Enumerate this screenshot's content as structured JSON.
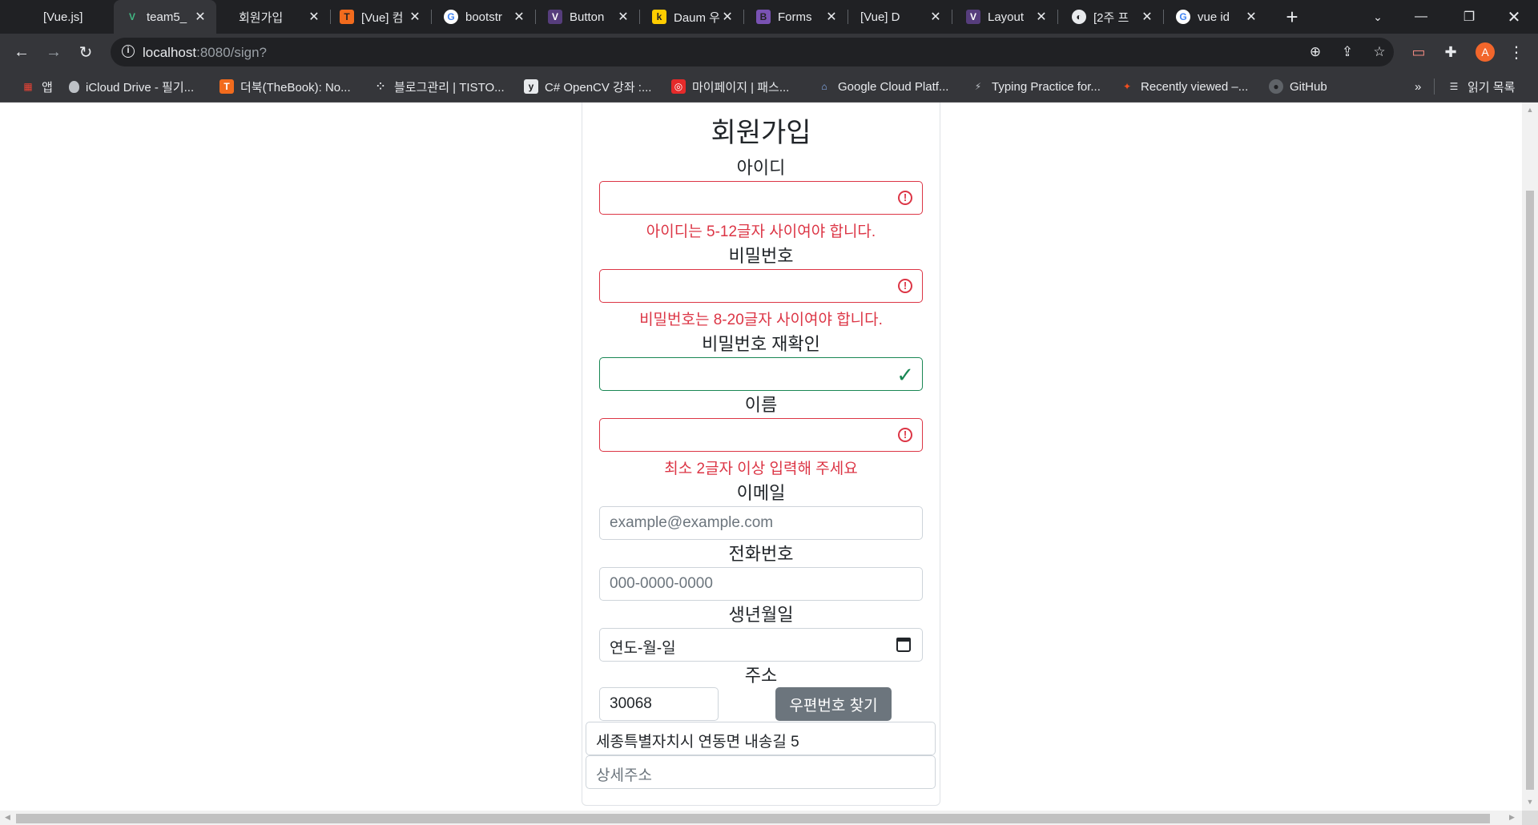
{
  "browser": {
    "tabs": [
      {
        "title": "[Vue.js]",
        "icon": "",
        "icon_bg": "",
        "active": false
      },
      {
        "title": "team5_",
        "icon": "V",
        "icon_bg": "vue",
        "active": true
      },
      {
        "title": "회원가입",
        "icon": "",
        "icon_bg": "",
        "active": false
      },
      {
        "title": "[Vue] 컴",
        "icon": "T",
        "icon_bg": "#f26b1d",
        "active": false
      },
      {
        "title": "bootstr",
        "icon": "G",
        "icon_bg": "google",
        "active": false
      },
      {
        "title": "Button",
        "icon": "V",
        "icon_bg": "bvue",
        "active": false
      },
      {
        "title": "Daum 우",
        "icon": "k",
        "icon_bg": "#ffcd00",
        "active": false
      },
      {
        "title": "Forms",
        "icon": "B",
        "icon_bg": "#7952b3",
        "active": false
      },
      {
        "title": "[Vue] D",
        "icon": "",
        "icon_bg": "",
        "active": false
      },
      {
        "title": "Layout",
        "icon": "V",
        "icon_bg": "bvue",
        "active": false
      },
      {
        "title": "[2주 프",
        "icon": "◐",
        "icon_bg": "globe",
        "active": false
      },
      {
        "title": "vue id",
        "icon": "G",
        "icon_bg": "google",
        "active": false
      }
    ],
    "url_host": "localhost",
    "url_path": ":8080/sign?",
    "profile_initial": "A",
    "bookmarks": [
      {
        "label": "앱",
        "icon": "apps-icon"
      },
      {
        "label": "iCloud Drive - 필기...",
        "icon": "apple-icon"
      },
      {
        "label": "더북(TheBook): No...",
        "icon": "thebook-icon"
      },
      {
        "label": "블로그관리 | TISTO...",
        "icon": "tistory-icon"
      },
      {
        "label": "C# OpenCV 강좌 :...",
        "icon": "opencv-icon"
      },
      {
        "label": "마이페이지 | 패스...",
        "icon": "fastcampus-icon"
      },
      {
        "label": "Google Cloud Platf...",
        "icon": "home-icon"
      },
      {
        "label": "Typing Practice for...",
        "icon": "typing-icon"
      },
      {
        "label": "Recently viewed –...",
        "icon": "figma-icon"
      },
      {
        "label": "GitHub",
        "icon": "github-icon"
      }
    ],
    "bookmarks_overflow": "»",
    "reading_list": "읽기 목록"
  },
  "form": {
    "title": "회원가입",
    "id_label": "아이디",
    "id_error": "아이디는 5-12글자 사이여야 합니다.",
    "pw_label": "비밀번호",
    "pw_error": "비밀번호는 8-20글자 사이여야 합니다.",
    "pw_confirm_label": "비밀번호 재확인",
    "name_label": "이름",
    "name_error": "최소 2글자 이상 입력해 주세요",
    "email_label": "이메일",
    "email_placeholder": "example@example.com",
    "phone_label": "전화번호",
    "phone_placeholder": "000-0000-0000",
    "birth_label": "생년월일",
    "birth_value": "연도-월-일",
    "address_label": "주소",
    "zip_value": "30068",
    "zip_button": "우편번호 찾기",
    "address_value": "세종특별자치시 연동면 내송길 5",
    "detail_placeholder": "상세주소"
  }
}
